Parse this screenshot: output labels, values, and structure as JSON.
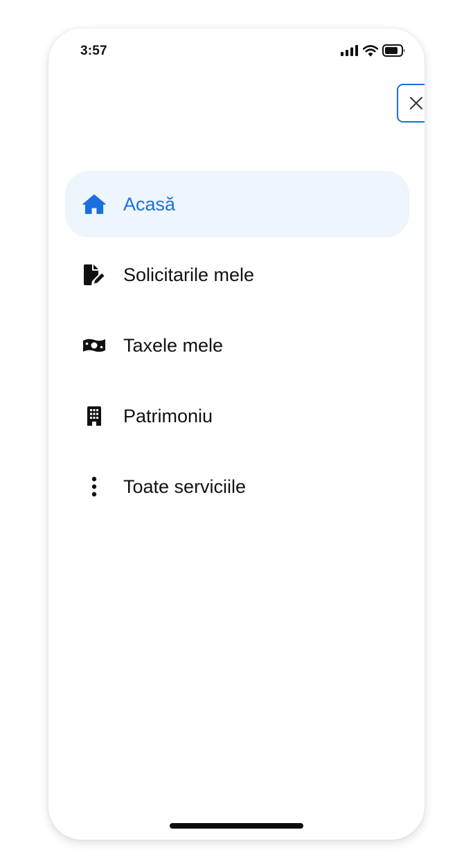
{
  "status_bar": {
    "time": "3:57",
    "icons": [
      "signal-icon",
      "wifi-icon",
      "battery-icon"
    ]
  },
  "close_button": {
    "icon": "close-icon"
  },
  "menu": {
    "items": [
      {
        "label": "Acasă",
        "icon": "home-icon",
        "active": true
      },
      {
        "label": "Solicitarile mele",
        "icon": "document-edit-icon",
        "active": false
      },
      {
        "label": "Taxele mele",
        "icon": "money-bill-icon",
        "active": false
      },
      {
        "label": "Patrimoniu",
        "icon": "building-icon",
        "active": false
      },
      {
        "label": "Toate serviciile",
        "icon": "more-vertical-icon",
        "active": false
      }
    ]
  },
  "colors": {
    "accent": "#1a6fdf",
    "active_background": "#eef5fd",
    "text": "#111111",
    "background": "#ffffff"
  }
}
